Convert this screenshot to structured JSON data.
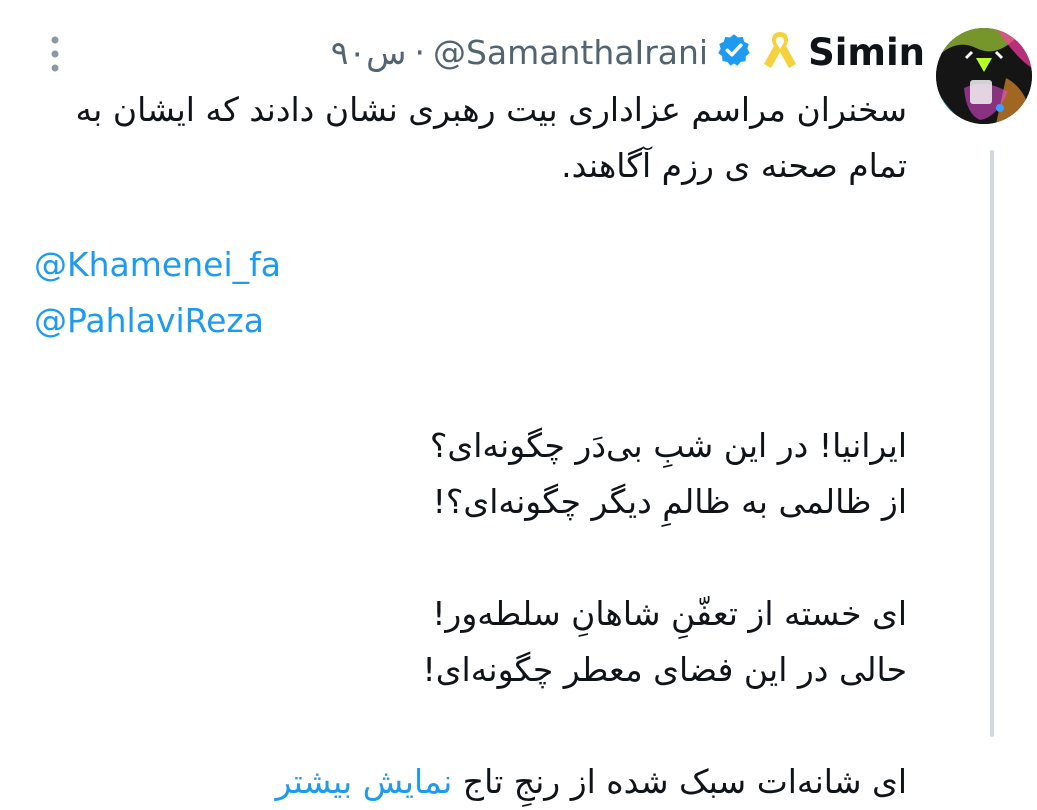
{
  "tweet": {
    "author_name": "Simin",
    "handle": "@SamanthaIrani",
    "separator": "·",
    "time": "۹۰س",
    "text": {
      "line1": "سخنران مراسم عزاداری بیت رهبری نشان دادند که ایشان به",
      "line2": "تمام صحنه ی رزم آگاهند.",
      "poem1": "ایرانیا! در این شبِ بی‌دَر چگونه‌ای؟",
      "poem2": "از ظالمی به ظالمِ دیگر چگونه‌ای؟!",
      "poem3": "ای خسته از تعفّنِ شاهانِ سلطه‌ور!",
      "poem4": "حالی در این فضای معطر چگونه‌ای!",
      "poem5": "ای شانه‌ات سبک شده از رنجِ تاج"
    },
    "mentions": [
      "@Khamenei_fa",
      "@PahlaviReza"
    ],
    "show_more_label": "نمایش بیشتر"
  },
  "icons": {
    "more": "vertical-ellipsis-icon",
    "verified": "verified-badge-icon",
    "ribbon": "yellow-ribbon-icon"
  },
  "colors": {
    "link": "#1d9bf0",
    "verified": "#1d9bf0",
    "ribbon": "#f5d13b",
    "muted": "#536471",
    "text": "#0f1419"
  }
}
